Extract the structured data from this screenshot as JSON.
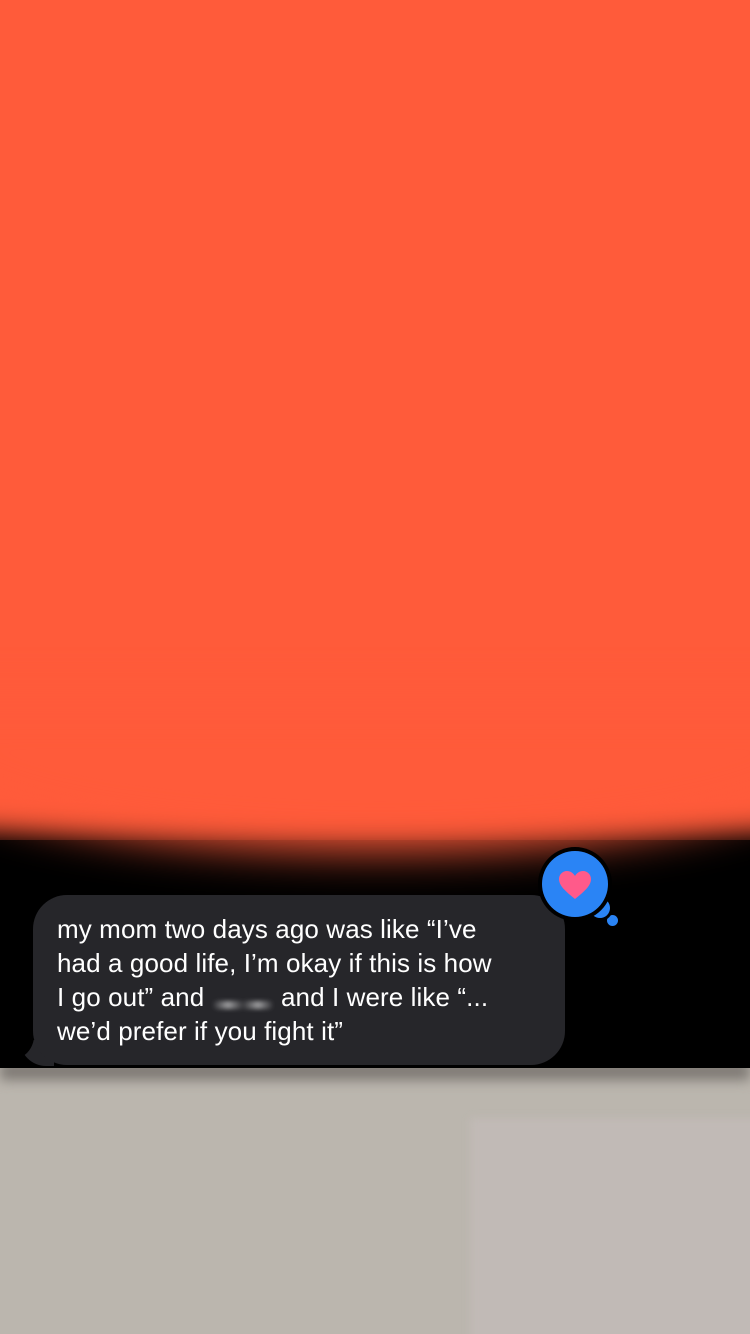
{
  "message": {
    "lines": [
      "my mom two days ago was like “I’ve",
      "had a good life, I’m okay if this is how",
      "I go out” and",
      "and I were like “...",
      "we’d prefer if you fight it”"
    ],
    "direction": "incoming"
  },
  "tapback": {
    "icon": "heart-icon",
    "bubble_color": "#2a84f5",
    "heart_color": "#ff5a8a"
  },
  "colors": {
    "bubble_background": "#26262a",
    "backdrop_top": "#ff5b3a",
    "backdrop_bottom": "#bbb6ae"
  }
}
